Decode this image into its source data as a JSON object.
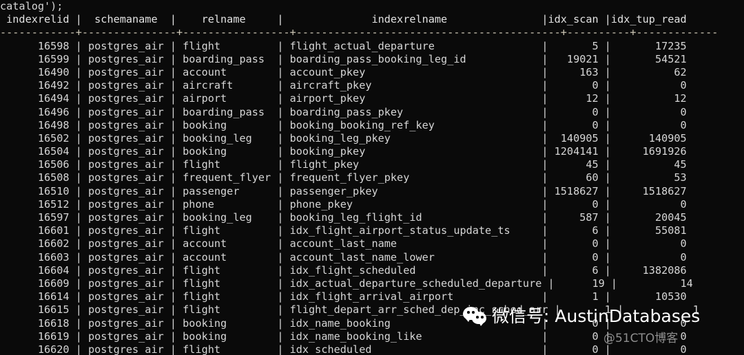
{
  "terminal": {
    "prompt_fragment": "catalog');",
    "colors": {
      "background": "#0a0a0a",
      "foreground": "#d6d6d6",
      "separator": "#cfc9b8",
      "watermark_text": "#ffffff",
      "watermark_sub": "#8e8e8e"
    }
  },
  "table": {
    "columns": [
      {
        "name": "indexrelid",
        "width": 11,
        "align": "right"
      },
      {
        "name": "schemaname",
        "width": 14,
        "align": "left"
      },
      {
        "name": "relname",
        "width": 16,
        "align": "left"
      },
      {
        "name": "indexrelname",
        "width": 41,
        "align": "left"
      },
      {
        "name": "idx_scan",
        "width": 9,
        "align": "right"
      },
      {
        "name": "idx_tup_read",
        "width": 13,
        "align": "right"
      }
    ],
    "rows": [
      {
        "indexrelid": "16598",
        "schemaname": "postgres_air",
        "relname": "flight",
        "indexrelname": "flight_actual_departure",
        "idx_scan": "5",
        "idx_tup_read": "17235"
      },
      {
        "indexrelid": "16599",
        "schemaname": "postgres_air",
        "relname": "boarding_pass",
        "indexrelname": "boarding_pass_booking_leg_id",
        "idx_scan": "19021",
        "idx_tup_read": "54521"
      },
      {
        "indexrelid": "16490",
        "schemaname": "postgres_air",
        "relname": "account",
        "indexrelname": "account_pkey",
        "idx_scan": "163",
        "idx_tup_read": "62"
      },
      {
        "indexrelid": "16492",
        "schemaname": "postgres_air",
        "relname": "aircraft",
        "indexrelname": "aircraft_pkey",
        "idx_scan": "0",
        "idx_tup_read": "0"
      },
      {
        "indexrelid": "16494",
        "schemaname": "postgres_air",
        "relname": "airport",
        "indexrelname": "airport_pkey",
        "idx_scan": "12",
        "idx_tup_read": "12"
      },
      {
        "indexrelid": "16496",
        "schemaname": "postgres_air",
        "relname": "boarding_pass",
        "indexrelname": "boarding_pass_pkey",
        "idx_scan": "0",
        "idx_tup_read": "0"
      },
      {
        "indexrelid": "16498",
        "schemaname": "postgres_air",
        "relname": "booking",
        "indexrelname": "booking_booking_ref_key",
        "idx_scan": "0",
        "idx_tup_read": "0"
      },
      {
        "indexrelid": "16502",
        "schemaname": "postgres_air",
        "relname": "booking_leg",
        "indexrelname": "booking_leg_pkey",
        "idx_scan": "140905",
        "idx_tup_read": "140905"
      },
      {
        "indexrelid": "16504",
        "schemaname": "postgres_air",
        "relname": "booking",
        "indexrelname": "booking_pkey",
        "idx_scan": "1204141",
        "idx_tup_read": "1691926"
      },
      {
        "indexrelid": "16506",
        "schemaname": "postgres_air",
        "relname": "flight",
        "indexrelname": "flight_pkey",
        "idx_scan": "45",
        "idx_tup_read": "45"
      },
      {
        "indexrelid": "16508",
        "schemaname": "postgres_air",
        "relname": "frequent_flyer",
        "indexrelname": "frequent_flyer_pkey",
        "idx_scan": "60",
        "idx_tup_read": "53"
      },
      {
        "indexrelid": "16510",
        "schemaname": "postgres_air",
        "relname": "passenger",
        "indexrelname": "passenger_pkey",
        "idx_scan": "1518627",
        "idx_tup_read": "1518627"
      },
      {
        "indexrelid": "16512",
        "schemaname": "postgres_air",
        "relname": "phone",
        "indexrelname": "phone_pkey",
        "idx_scan": "0",
        "idx_tup_read": "0"
      },
      {
        "indexrelid": "16597",
        "schemaname": "postgres_air",
        "relname": "booking_leg",
        "indexrelname": "booking_leg_flight_id",
        "idx_scan": "587",
        "idx_tup_read": "20045"
      },
      {
        "indexrelid": "16601",
        "schemaname": "postgres_air",
        "relname": "flight",
        "indexrelname": "idx_flight_airport_status_update_ts",
        "idx_scan": "6",
        "idx_tup_read": "55081"
      },
      {
        "indexrelid": "16602",
        "schemaname": "postgres_air",
        "relname": "account",
        "indexrelname": "account_last_name",
        "idx_scan": "0",
        "idx_tup_read": "0"
      },
      {
        "indexrelid": "16603",
        "schemaname": "postgres_air",
        "relname": "account",
        "indexrelname": "account_last_name_lower",
        "idx_scan": "0",
        "idx_tup_read": "0"
      },
      {
        "indexrelid": "16604",
        "schemaname": "postgres_air",
        "relname": "flight",
        "indexrelname": "idx_flight_scheduled",
        "idx_scan": "6",
        "idx_tup_read": "1382086"
      },
      {
        "indexrelid": "16609",
        "schemaname": "postgres_air",
        "relname": "flight",
        "indexrelname": "idx_actual_departure_scheduled_departure",
        "idx_scan": "19",
        "idx_tup_read": "14"
      },
      {
        "indexrelid": "16614",
        "schemaname": "postgres_air",
        "relname": "flight",
        "indexrelname": "idx_flight_arrival_airport",
        "idx_scan": "1",
        "idx_tup_read": "10530"
      },
      {
        "indexrelid": "16615",
        "schemaname": "postgres_air",
        "relname": "flight",
        "indexrelname": "flight_depart_arr_sched_dep_inc_sched_arr",
        "idx_scan": "1",
        "idx_tup_read": "1"
      },
      {
        "indexrelid": "16618",
        "schemaname": "postgres_air",
        "relname": "booking",
        "indexrelname": "idx_name_booking",
        "idx_scan": "0",
        "idx_tup_read": "0"
      },
      {
        "indexrelid": "16619",
        "schemaname": "postgres_air",
        "relname": "booking",
        "indexrelname": "idx_name_booking_like",
        "idx_scan": "0",
        "idx_tup_read": "0"
      },
      {
        "indexrelid": "16620",
        "schemaname": "postgres_air",
        "relname": "flight",
        "indexrelname": "idx_scheduled",
        "idx_scan": "0",
        "idx_tup_read": "0"
      }
    ]
  },
  "watermark": {
    "icon": "wechat-icon",
    "text": "微信号: AustinDatabases",
    "subtext": "@51CTO博客"
  }
}
